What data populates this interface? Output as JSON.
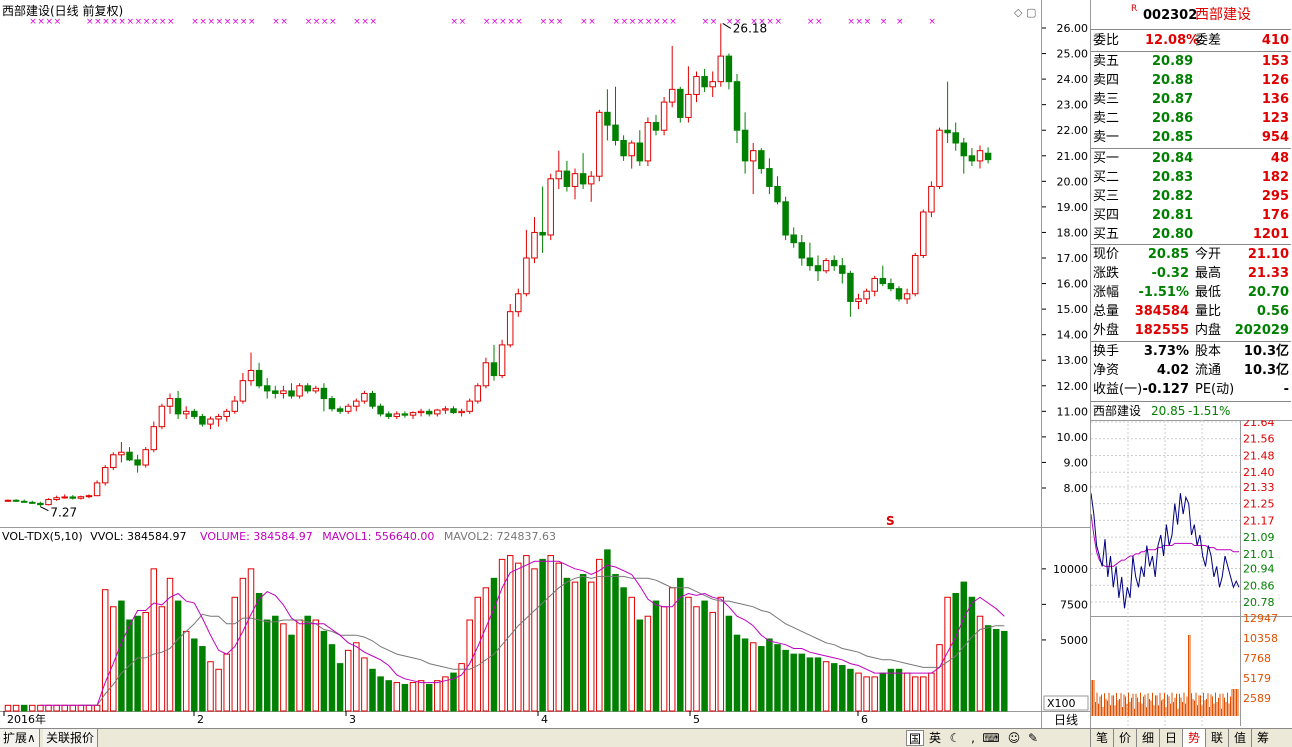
{
  "title": "西部建设(日线 前复权)",
  "peak_label": "26.18",
  "low_label": "7.27",
  "s_marker": "S",
  "price_ticks": [
    "26.00",
    "25.00",
    "24.00",
    "23.00",
    "22.00",
    "21.00",
    "20.00",
    "19.00",
    "18.00",
    "17.00",
    "16.00",
    "15.00",
    "14.00",
    "13.00",
    "12.00",
    "11.00",
    "10.00",
    "9.00",
    "8.00"
  ],
  "vol_indicator": {
    "name": "VOL-TDX(5,10)",
    "vvol": "VVOL: 384584.97",
    "volume": "VOLUME: 384584.97",
    "mavol1": "MAVOL1: 556640.00",
    "mavol2": "MAVOL2: 724837.63"
  },
  "vol_ticks": [
    "10000",
    "7500",
    "5000"
  ],
  "vol_unit": "X100",
  "date_axis": [
    "2016年",
    "2",
    "3",
    "4",
    "5",
    "6"
  ],
  "period": "日线",
  "quote": {
    "code": "002302",
    "name": "西部建设",
    "r_mark": "R",
    "weibi_label": "委比",
    "weibi": "12.08%",
    "weicha_label": "委差",
    "weicha": "410",
    "asks": [
      {
        "label": "卖五",
        "price": "20.89",
        "vol": "153"
      },
      {
        "label": "卖四",
        "price": "20.88",
        "vol": "126"
      },
      {
        "label": "卖三",
        "price": "20.87",
        "vol": "136"
      },
      {
        "label": "卖二",
        "price": "20.86",
        "vol": "123"
      },
      {
        "label": "卖一",
        "price": "20.85",
        "vol": "954"
      }
    ],
    "bids": [
      {
        "label": "买一",
        "price": "20.84",
        "vol": "48"
      },
      {
        "label": "买二",
        "price": "20.83",
        "vol": "182"
      },
      {
        "label": "买三",
        "price": "20.82",
        "vol": "295"
      },
      {
        "label": "买四",
        "price": "20.81",
        "vol": "176"
      },
      {
        "label": "买五",
        "price": "20.80",
        "vol": "1201"
      }
    ],
    "stats": [
      {
        "l1": "现价",
        "v1": "20.85",
        "c1": "grn",
        "l2": "今开",
        "v2": "21.10",
        "c2": "red"
      },
      {
        "l1": "涨跌",
        "v1": "-0.32",
        "c1": "grn",
        "l2": "最高",
        "v2": "21.33",
        "c2": "red"
      },
      {
        "l1": "涨幅",
        "v1": "-1.51%",
        "c1": "grn",
        "l2": "最低",
        "v2": "20.70",
        "c2": "grn"
      },
      {
        "l1": "总量",
        "v1": "384584",
        "c1": "red",
        "l2": "量比",
        "v2": "0.56",
        "c2": "grn"
      },
      {
        "l1": "外盘",
        "v1": "182555",
        "c1": "red",
        "l2": "内盘",
        "v2": "202029",
        "c2": "grn"
      }
    ],
    "stats2": [
      {
        "l1": "换手",
        "v1": "3.73%",
        "l2": "股本",
        "v2": "10.3亿"
      },
      {
        "l1": "净资",
        "v1": "4.02",
        "l2": "流通",
        "v2": "10.3亿"
      },
      {
        "l1": "收益(一)",
        "v1": "-0.127",
        "l2": "PE(动)",
        "v2": "-"
      }
    ]
  },
  "mini": {
    "name": "西部建设",
    "price": "20.85",
    "pct": "-1.51%",
    "price_ticks": [
      "21.64",
      "21.56",
      "21.48",
      "21.40",
      "21.33",
      "21.25",
      "21.17",
      "21.09",
      "21.01",
      "20.94",
      "20.86",
      "20.78"
    ],
    "vol_ticks": [
      "12947",
      "10358",
      "7768",
      "5179",
      "2589"
    ]
  },
  "bottom": {
    "expand": "扩展∧",
    "related": "关联报价",
    "guo": "国",
    "ying": "英",
    "right_tabs": [
      "笔",
      "价",
      "细",
      "日",
      "势",
      "联",
      "值",
      "筹"
    ]
  },
  "chart_data": {
    "type": "candlestick",
    "title": "西部建设(日线 前复权)",
    "ylim": [
      7.0,
      26.5
    ],
    "ohlc": [
      [
        7.5,
        7.55,
        7.45,
        7.52
      ],
      [
        7.52,
        7.56,
        7.46,
        7.48
      ],
      [
        7.48,
        7.55,
        7.42,
        7.44
      ],
      [
        7.44,
        7.5,
        7.38,
        7.4
      ],
      [
        7.4,
        7.46,
        7.27,
        7.35
      ],
      [
        7.35,
        7.6,
        7.32,
        7.55
      ],
      [
        7.55,
        7.7,
        7.5,
        7.62
      ],
      [
        7.62,
        7.75,
        7.58,
        7.65
      ],
      [
        7.65,
        7.72,
        7.55,
        7.6
      ],
      [
        7.6,
        7.7,
        7.55,
        7.66
      ],
      [
        7.66,
        7.75,
        7.6,
        7.7
      ],
      [
        7.7,
        8.3,
        7.68,
        8.2
      ],
      [
        8.2,
        8.9,
        8.1,
        8.8
      ],
      [
        8.8,
        9.4,
        8.7,
        9.3
      ],
      [
        9.3,
        9.8,
        9.0,
        9.4
      ],
      [
        9.4,
        9.6,
        9.05,
        9.1
      ],
      [
        9.1,
        9.3,
        8.6,
        8.9
      ],
      [
        8.9,
        9.6,
        8.8,
        9.5
      ],
      [
        9.5,
        10.6,
        9.4,
        10.4
      ],
      [
        10.4,
        11.3,
        10.3,
        11.2
      ],
      [
        11.2,
        11.7,
        10.9,
        11.5
      ],
      [
        11.5,
        11.8,
        10.7,
        10.9
      ],
      [
        10.9,
        11.2,
        10.7,
        11.0
      ],
      [
        11.0,
        11.1,
        10.7,
        10.8
      ],
      [
        10.8,
        10.9,
        10.4,
        10.5
      ],
      [
        10.5,
        10.8,
        10.3,
        10.7
      ],
      [
        10.7,
        10.9,
        10.4,
        10.8
      ],
      [
        10.8,
        11.1,
        10.6,
        11.0
      ],
      [
        11.0,
        11.6,
        10.9,
        11.4
      ],
      [
        11.4,
        12.5,
        11.3,
        12.2
      ],
      [
        12.2,
        13.3,
        12.0,
        12.6
      ],
      [
        12.6,
        12.9,
        11.9,
        12.0
      ],
      [
        12.0,
        12.3,
        11.5,
        11.8
      ],
      [
        11.8,
        12.0,
        11.5,
        11.7
      ],
      [
        11.7,
        12.0,
        11.5,
        11.8
      ],
      [
        11.8,
        12.1,
        11.5,
        11.6
      ],
      [
        11.6,
        12.1,
        11.5,
        12.0
      ],
      [
        12.0,
        12.1,
        11.7,
        11.8
      ],
      [
        11.8,
        12.0,
        11.7,
        11.9
      ],
      [
        11.9,
        12.1,
        11.0,
        11.5
      ],
      [
        11.5,
        11.6,
        11.0,
        11.1
      ],
      [
        11.1,
        11.2,
        10.9,
        11.0
      ],
      [
        11.0,
        11.3,
        10.9,
        11.2
      ],
      [
        11.2,
        11.5,
        11.0,
        11.4
      ],
      [
        11.4,
        11.8,
        11.3,
        11.7
      ],
      [
        11.7,
        11.8,
        11.1,
        11.2
      ],
      [
        11.2,
        11.3,
        10.8,
        10.9
      ],
      [
        10.9,
        11.0,
        10.7,
        10.8
      ],
      [
        10.8,
        11.0,
        10.7,
        10.9
      ],
      [
        10.9,
        11.0,
        10.75,
        10.85
      ],
      [
        10.85,
        11.0,
        10.7,
        10.95
      ],
      [
        10.95,
        11.1,
        10.8,
        11.0
      ],
      [
        11.0,
        11.1,
        10.8,
        10.9
      ],
      [
        10.9,
        11.1,
        10.8,
        11.05
      ],
      [
        11.05,
        11.2,
        10.9,
        11.1
      ],
      [
        11.1,
        11.2,
        10.9,
        10.95
      ],
      [
        10.95,
        11.1,
        10.8,
        11.0
      ],
      [
        11.0,
        11.5,
        10.9,
        11.4
      ],
      [
        11.4,
        12.1,
        11.3,
        12.0
      ],
      [
        12.0,
        13.1,
        11.9,
        12.9
      ],
      [
        12.9,
        13.6,
        12.2,
        12.4
      ],
      [
        12.4,
        13.8,
        12.3,
        13.6
      ],
      [
        13.6,
        15.2,
        13.5,
        14.9
      ],
      [
        14.9,
        15.8,
        14.7,
        15.6
      ],
      [
        15.6,
        18.1,
        15.5,
        17.0
      ],
      [
        17.0,
        18.6,
        16.8,
        18.0
      ],
      [
        18.0,
        19.8,
        17.2,
        17.9
      ],
      [
        17.9,
        20.3,
        17.7,
        20.1
      ],
      [
        20.1,
        21.2,
        19.7,
        20.4
      ],
      [
        20.4,
        20.8,
        19.6,
        19.8
      ],
      [
        19.8,
        20.5,
        19.3,
        20.3
      ],
      [
        20.3,
        21.1,
        19.7,
        19.9
      ],
      [
        19.9,
        20.4,
        19.2,
        20.2
      ],
      [
        20.2,
        22.8,
        20.0,
        22.7
      ],
      [
        22.7,
        23.6,
        21.6,
        22.2
      ],
      [
        22.2,
        23.7,
        21.4,
        21.6
      ],
      [
        21.6,
        21.8,
        20.8,
        21.0
      ],
      [
        21.0,
        21.6,
        20.5,
        21.5
      ],
      [
        21.5,
        22.0,
        20.6,
        20.8
      ],
      [
        20.8,
        22.5,
        20.6,
        22.3
      ],
      [
        22.3,
        22.6,
        21.8,
        22.0
      ],
      [
        22.0,
        23.3,
        21.8,
        23.1
      ],
      [
        23.1,
        25.3,
        22.9,
        23.6
      ],
      [
        23.6,
        23.7,
        22.3,
        22.5
      ],
      [
        22.5,
        24.5,
        22.3,
        23.4
      ],
      [
        23.4,
        24.3,
        23.1,
        24.1
      ],
      [
        24.1,
        24.4,
        23.5,
        23.7
      ],
      [
        23.7,
        24.3,
        23.3,
        23.9
      ],
      [
        23.9,
        26.18,
        23.7,
        24.9
      ],
      [
        24.9,
        25.0,
        23.6,
        23.9
      ],
      [
        23.9,
        24.2,
        21.5,
        22.0
      ],
      [
        22.0,
        22.7,
        20.3,
        20.8
      ],
      [
        20.8,
        21.5,
        19.5,
        21.2
      ],
      [
        21.2,
        21.3,
        20.3,
        20.5
      ],
      [
        20.5,
        20.9,
        19.5,
        19.8
      ],
      [
        19.8,
        20.2,
        19.1,
        19.2
      ],
      [
        19.2,
        19.4,
        17.7,
        17.9
      ],
      [
        17.9,
        18.2,
        17.4,
        17.6
      ],
      [
        17.6,
        17.9,
        16.7,
        17.0
      ],
      [
        17.0,
        17.6,
        16.5,
        16.7
      ],
      [
        16.7,
        17.1,
        16.1,
        16.5
      ],
      [
        16.5,
        17.0,
        16.4,
        16.9
      ],
      [
        16.9,
        17.1,
        16.5,
        16.7
      ],
      [
        16.7,
        17.0,
        16.0,
        16.4
      ],
      [
        16.4,
        16.5,
        14.7,
        15.3
      ],
      [
        15.3,
        15.6,
        15.0,
        15.4
      ],
      [
        15.4,
        15.8,
        15.2,
        15.7
      ],
      [
        15.7,
        16.3,
        15.5,
        16.2
      ],
      [
        16.2,
        16.7,
        15.9,
        16.0
      ],
      [
        16.0,
        16.2,
        15.7,
        15.8
      ],
      [
        15.8,
        15.9,
        15.3,
        15.4
      ],
      [
        15.4,
        15.8,
        15.2,
        15.6
      ],
      [
        15.6,
        17.2,
        15.5,
        17.1
      ],
      [
        17.1,
        18.9,
        17.0,
        18.8
      ],
      [
        18.8,
        20.0,
        18.6,
        19.8
      ],
      [
        19.8,
        22.1,
        19.7,
        22.0
      ],
      [
        22.0,
        23.9,
        21.5,
        21.9
      ],
      [
        21.9,
        22.3,
        21.2,
        21.5
      ],
      [
        21.5,
        21.7,
        20.3,
        21.0
      ],
      [
        21.0,
        21.3,
        20.6,
        20.8
      ],
      [
        20.8,
        21.4,
        20.5,
        21.2
      ],
      [
        21.1,
        21.33,
        20.7,
        20.85
      ]
    ],
    "volume": [
      3,
      3,
      3,
      3,
      3,
      3,
      3,
      3,
      3,
      3,
      3,
      3,
      64,
      55,
      58,
      48,
      50,
      52,
      75,
      55,
      70,
      58,
      42,
      38,
      34,
      26,
      22,
      30,
      60,
      70,
      75,
      62,
      48,
      50,
      46,
      40,
      48,
      50,
      48,
      42,
      35,
      25,
      32,
      36,
      28,
      22,
      18,
      16,
      15,
      14,
      15,
      16,
      14,
      16,
      18,
      20,
      25,
      48,
      60,
      65,
      70,
      80,
      82,
      78,
      82,
      75,
      80,
      82,
      78,
      70,
      68,
      72,
      68,
      80,
      85,
      72,
      65,
      60,
      48,
      50,
      58,
      55,
      65,
      70,
      60,
      55,
      58,
      52,
      60,
      50,
      40,
      38,
      36,
      34,
      38,
      35,
      32,
      30,
      30,
      28,
      28,
      26,
      25,
      24,
      22,
      20,
      18,
      18,
      20,
      22,
      22,
      20,
      18,
      18,
      20,
      35,
      60,
      62,
      68,
      60,
      50,
      45,
      43,
      42
    ],
    "vol_up": [
      true,
      true,
      false,
      true,
      true,
      true,
      true,
      true,
      true,
      true,
      true,
      true,
      true,
      true,
      false,
      false,
      false,
      true,
      true,
      true,
      true,
      false,
      true,
      false,
      false,
      true,
      true,
      true,
      true,
      true,
      true,
      false,
      false,
      false,
      true,
      false,
      true,
      false,
      true,
      false,
      false,
      false,
      true,
      true,
      true,
      false,
      false,
      false,
      true,
      false,
      true,
      true,
      false,
      true,
      true,
      false,
      true,
      true,
      true,
      true,
      false,
      true,
      true,
      true,
      true,
      true,
      false,
      true,
      true,
      false,
      true,
      false,
      true,
      true,
      false,
      false,
      false,
      true,
      false,
      true,
      false,
      true,
      true,
      false,
      true,
      true,
      false,
      true,
      true,
      false,
      false,
      false,
      true,
      false,
      false,
      false,
      false,
      false,
      false,
      false,
      false,
      true,
      false,
      false,
      false,
      true,
      true,
      true,
      false,
      false,
      false,
      true,
      true,
      true,
      true,
      true,
      true,
      false,
      false,
      false,
      true,
      false,
      false,
      false
    ],
    "mavol1": [
      null,
      null,
      null,
      null,
      3,
      3,
      3,
      3,
      3,
      3,
      3,
      3,
      15,
      25,
      36,
      45,
      53,
      53,
      57,
      56,
      60,
      62,
      58,
      57,
      49,
      40,
      32,
      30,
      34,
      42,
      51,
      59,
      63,
      61,
      56,
      49,
      46,
      46,
      46,
      46,
      43,
      40,
      36,
      34,
      31,
      29,
      27,
      24,
      19,
      17,
      16,
      15,
      15,
      15,
      16,
      17,
      19,
      25,
      34,
      44,
      54,
      65,
      73,
      75,
      77,
      79,
      79,
      79,
      79,
      77,
      75,
      74,
      72,
      74,
      77,
      76,
      74,
      72,
      66,
      59,
      56,
      55,
      55,
      60,
      62,
      61,
      62,
      60,
      59,
      55,
      50,
      48,
      45,
      40,
      37,
      36,
      35,
      33,
      33,
      31,
      30,
      29,
      28,
      27,
      25,
      24,
      22,
      20,
      20,
      20,
      20,
      20,
      20,
      20,
      20,
      23,
      31,
      39,
      49,
      57,
      60,
      57,
      54,
      50
    ],
    "mavol2": [
      null,
      null,
      null,
      null,
      null,
      null,
      null,
      null,
      null,
      3,
      3,
      3,
      9,
      14,
      20,
      24,
      28,
      28,
      30,
      31,
      33,
      38,
      42,
      46,
      51,
      50,
      50,
      46,
      46,
      49,
      49,
      48,
      47,
      47,
      48,
      48,
      48,
      47,
      46,
      43,
      42,
      40,
      40,
      40,
      39,
      37,
      34,
      32,
      30,
      29,
      28,
      27,
      25,
      24,
      23,
      22,
      22,
      22,
      24,
      27,
      30,
      35,
      40,
      45,
      49,
      53,
      57,
      61,
      65,
      68,
      70,
      71,
      70,
      71,
      71,
      71,
      71,
      70,
      70,
      70,
      69,
      67,
      65,
      65,
      65,
      63,
      61,
      59,
      58,
      58,
      57,
      56,
      55,
      53,
      52,
      49,
      46,
      44,
      42,
      40,
      38,
      36,
      35,
      33,
      32,
      31,
      29,
      28,
      27,
      27,
      26,
      25,
      24,
      23,
      23,
      23,
      26,
      29,
      34,
      39,
      43,
      44,
      45,
      45
    ],
    "mini_price": [
      21.3,
      21.2,
      21.05,
      21.0,
      20.95,
      21.08,
      20.9,
      21.0,
      20.85,
      20.95,
      20.8,
      20.9,
      20.75,
      20.85,
      20.8,
      21.0,
      20.9,
      20.85,
      20.95,
      20.9,
      21.05,
      20.95,
      21.0,
      20.9,
      21.05,
      21.1,
      21.0,
      21.15,
      21.05,
      21.1,
      21.25,
      21.15,
      21.3,
      21.2,
      21.28,
      21.25,
      21.1,
      21.15,
      21.05,
      21.1,
      21.0,
      20.95,
      21.05,
      21.0,
      20.9,
      20.95,
      20.85,
      20.9,
      21.0,
      20.95,
      20.9,
      20.85,
      20.88,
      20.85
    ],
    "mini_avg": [
      21.2,
      21.1,
      21.02,
      20.98,
      20.96,
      20.95,
      20.95,
      20.95,
      20.95,
      20.96,
      20.97,
      20.98,
      20.98,
      20.99,
      21.0,
      21.0,
      21.01,
      21.01,
      21.02,
      21.02,
      21.03,
      21.03,
      21.03,
      21.03,
      21.04,
      21.04,
      21.05,
      21.05,
      21.05,
      21.05,
      21.06,
      21.06,
      21.06,
      21.06,
      21.06,
      21.06,
      21.06,
      21.05,
      21.05,
      21.05,
      21.05,
      21.05,
      21.04,
      21.04,
      21.04,
      21.03,
      21.03,
      21.03,
      21.03,
      21.03,
      21.03,
      21.02,
      21.02,
      21.02
    ]
  }
}
